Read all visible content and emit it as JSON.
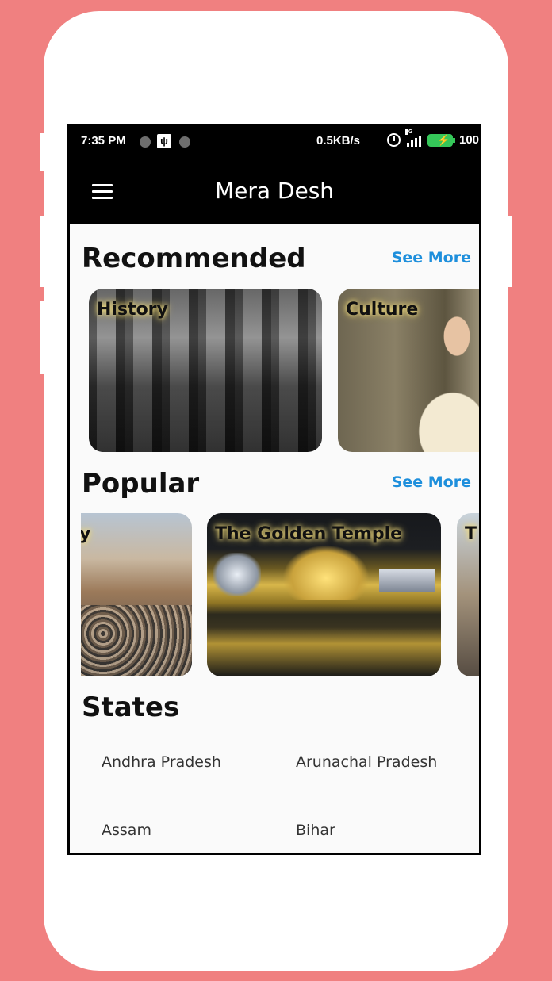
{
  "status_bar": {
    "time": "7:35 PM",
    "net_speed": "0.5KB/s",
    "network": "4G",
    "battery": "100%"
  },
  "app_bar": {
    "title": "Mera Desh"
  },
  "recommended": {
    "title": "Recommended",
    "see_more": "See More",
    "cards": [
      {
        "label": "History"
      },
      {
        "label": "Culture"
      }
    ]
  },
  "popular": {
    "title": "Popular",
    "see_more": "See More",
    "cards": [
      {
        "label": "y"
      },
      {
        "label": "The Golden Temple"
      },
      {
        "label": "T"
      }
    ]
  },
  "states": {
    "title": "States",
    "items": [
      "Andhra Pradesh",
      "Arunachal Pradesh",
      "Assam",
      "Bihar"
    ]
  },
  "colors": {
    "background": "#f08080",
    "accent": "#1e8fdc",
    "app_bar": "#000000"
  }
}
